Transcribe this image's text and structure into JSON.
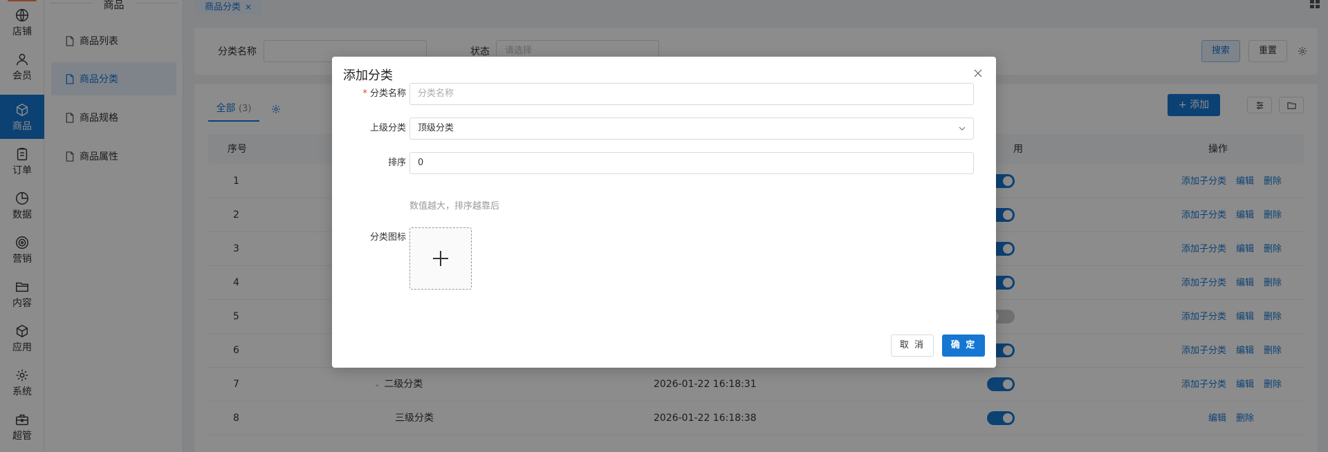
{
  "rail": [
    {
      "label": "店铺",
      "icon": "globe-icon"
    },
    {
      "label": "会员",
      "icon": "user-icon"
    },
    {
      "label": "商品",
      "icon": "box-icon",
      "active": true
    },
    {
      "label": "订单",
      "icon": "clipboard-icon"
    },
    {
      "label": "数据",
      "icon": "pie-chart-icon"
    },
    {
      "label": "营销",
      "icon": "target-icon"
    },
    {
      "label": "内容",
      "icon": "folder-icon"
    },
    {
      "label": "应用",
      "icon": "cube-icon"
    },
    {
      "label": "系统",
      "icon": "gear-icon"
    },
    {
      "label": "超管",
      "icon": "toolbox-icon"
    }
  ],
  "submenu": {
    "title": "商品",
    "items": [
      {
        "label": "商品列表"
      },
      {
        "label": "商品分类",
        "active": true
      },
      {
        "label": "商品规格"
      },
      {
        "label": "商品属性"
      }
    ]
  },
  "tabbar": {
    "tab_label": "商品分类",
    "close": "×"
  },
  "search": {
    "name_label": "分类名称",
    "name_placeholder": "",
    "status_label": "状态",
    "status_placeholder": "请选择",
    "search_button": "搜索",
    "reset_button": "重置"
  },
  "table": {
    "tab_all": "全部",
    "tab_count": "(3)",
    "add_button": "+ 添加",
    "headers": {
      "index": "序号",
      "enabled": "用",
      "actions": "操作"
    },
    "rows": [
      {
        "index": "1",
        "name": "",
        "time": "",
        "enabled": true,
        "ops": [
          "添加子分类",
          "编辑",
          "删除"
        ]
      },
      {
        "index": "2",
        "name": "",
        "time": "",
        "enabled": true,
        "ops": [
          "添加子分类",
          "编辑",
          "删除"
        ]
      },
      {
        "index": "3",
        "name": "",
        "time": "",
        "enabled": true,
        "ops": [
          "添加子分类",
          "编辑",
          "删除"
        ]
      },
      {
        "index": "4",
        "name": "",
        "time": "",
        "enabled": true,
        "ops": [
          "添加子分类",
          "编辑",
          "删除"
        ]
      },
      {
        "index": "5",
        "name": "",
        "time": "",
        "enabled": false,
        "ops": [
          "添加子分类",
          "编辑",
          "删除"
        ]
      },
      {
        "index": "6",
        "name": "",
        "time": "",
        "enabled": true,
        "ops": [
          "添加子分类",
          "编辑",
          "删除"
        ]
      },
      {
        "index": "7",
        "name": "二级分类",
        "time": "2026-01-22 16:18:31",
        "enabled": true,
        "expand": true,
        "ops": [
          "添加子分类",
          "编辑",
          "删除"
        ]
      },
      {
        "index": "8",
        "name": "三级分类",
        "time": "2026-01-22 16:18:38",
        "enabled": true,
        "ops": [
          "编辑",
          "删除"
        ]
      }
    ]
  },
  "dialog": {
    "title": "添加分类",
    "required_mark": "*",
    "name_label": "分类名称",
    "name_placeholder": "分类名称",
    "parent_label": "上级分类",
    "parent_value": "顶级分类",
    "sort_label": "排序",
    "sort_value": "0",
    "sort_hint": "数值越大，排序越靠后",
    "icon_label": "分类图标",
    "cancel": "取 消",
    "confirm": "确 定"
  },
  "colors": {
    "primary": "#1677d2",
    "required": "#e53935"
  }
}
